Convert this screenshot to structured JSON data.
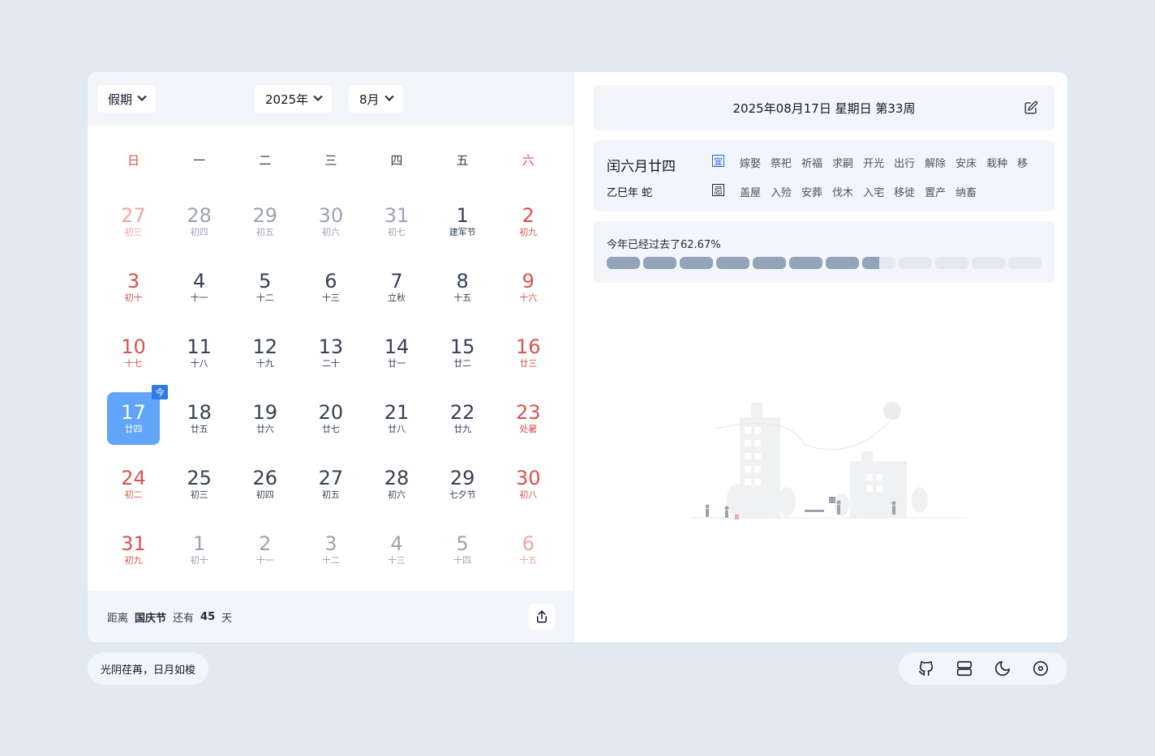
{
  "header": {
    "holiday_select": "假期",
    "year_select": "2025年",
    "month_select": "8月"
  },
  "weekdays": [
    "日",
    "一",
    "二",
    "三",
    "四",
    "五",
    "六"
  ],
  "days": [
    {
      "num": "27",
      "lunar": "初三",
      "other": true,
      "we": true
    },
    {
      "num": "28",
      "lunar": "初四",
      "other": true
    },
    {
      "num": "29",
      "lunar": "初五",
      "other": true
    },
    {
      "num": "30",
      "lunar": "初六",
      "other": true
    },
    {
      "num": "31",
      "lunar": "初七",
      "other": true
    },
    {
      "num": "1",
      "lunar": "建军节"
    },
    {
      "num": "2",
      "lunar": "初九",
      "we": true
    },
    {
      "num": "3",
      "lunar": "初十",
      "we": true
    },
    {
      "num": "4",
      "lunar": "十一"
    },
    {
      "num": "5",
      "lunar": "十二"
    },
    {
      "num": "6",
      "lunar": "十三"
    },
    {
      "num": "7",
      "lunar": "立秋"
    },
    {
      "num": "8",
      "lunar": "十五"
    },
    {
      "num": "9",
      "lunar": "十六",
      "we": true
    },
    {
      "num": "10",
      "lunar": "十七",
      "we": true
    },
    {
      "num": "11",
      "lunar": "十八"
    },
    {
      "num": "12",
      "lunar": "十九"
    },
    {
      "num": "13",
      "lunar": "二十"
    },
    {
      "num": "14",
      "lunar": "廿一"
    },
    {
      "num": "15",
      "lunar": "廿二"
    },
    {
      "num": "16",
      "lunar": "廿三",
      "we": true
    },
    {
      "num": "17",
      "lunar": "廿四",
      "we": true,
      "today": true
    },
    {
      "num": "18",
      "lunar": "廿五"
    },
    {
      "num": "19",
      "lunar": "廿六"
    },
    {
      "num": "20",
      "lunar": "廿七"
    },
    {
      "num": "21",
      "lunar": "廿八"
    },
    {
      "num": "22",
      "lunar": "廿九"
    },
    {
      "num": "23",
      "lunar": "处暑",
      "we": true
    },
    {
      "num": "24",
      "lunar": "初二",
      "we": true
    },
    {
      "num": "25",
      "lunar": "初三"
    },
    {
      "num": "26",
      "lunar": "初四"
    },
    {
      "num": "27",
      "lunar": "初五"
    },
    {
      "num": "28",
      "lunar": "初六"
    },
    {
      "num": "29",
      "lunar": "七夕节"
    },
    {
      "num": "30",
      "lunar": "初八",
      "we": true
    },
    {
      "num": "31",
      "lunar": "初九",
      "we": true
    },
    {
      "num": "1",
      "lunar": "初十",
      "other": true
    },
    {
      "num": "2",
      "lunar": "十一",
      "other": true
    },
    {
      "num": "3",
      "lunar": "十二",
      "other": true
    },
    {
      "num": "4",
      "lunar": "十三",
      "other": true
    },
    {
      "num": "5",
      "lunar": "十四",
      "other": true
    },
    {
      "num": "6",
      "lunar": "十五",
      "other": true,
      "we": true
    }
  ],
  "today_badge": "今",
  "footer": {
    "prefix": "距离",
    "holiday": "国庆节",
    "middle": "还有",
    "days": "45",
    "suffix": "天"
  },
  "detail": {
    "date_line": "2025年08月17日 星期日 第33周",
    "lunar_month": "闰六月廿四",
    "lunar_year": "乙巳年 蛇",
    "yi_label": "宜",
    "ji_label": "忌",
    "yi": [
      "嫁娶",
      "祭祀",
      "祈福",
      "求嗣",
      "开光",
      "出行",
      "解除",
      "安床",
      "栽种",
      "移"
    ],
    "ji": [
      "盖屋",
      "入殓",
      "安葬",
      "伐木",
      "入宅",
      "移徙",
      "置产",
      "纳畜"
    ],
    "progress_text": "今年已经过去了62.67%",
    "progress": 0.6267,
    "segments": 12
  },
  "motto": "光阴荏苒，日月如梭",
  "icons": {
    "github": "github-icon",
    "layout": "layout-icon",
    "theme": "moon-icon",
    "settings": "settings-icon"
  },
  "colors": {
    "weekend": "#d9534f",
    "today_bg": "#60a5fa",
    "badge": "#2f7ae6",
    "progress_fill": "#94a3b8"
  }
}
